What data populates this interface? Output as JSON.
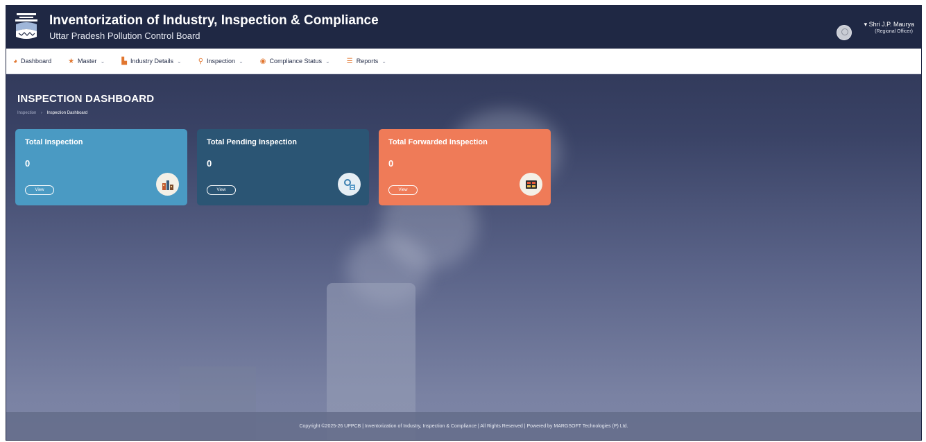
{
  "header": {
    "title": "Inventorization of Industry, Inspection & Compliance",
    "subtitle": "Uttar Pradesh Pollution Control Board",
    "user_name": "Shri J.P. Maurya",
    "user_role": "(Regional Officer)"
  },
  "nav": {
    "items": [
      {
        "label": "Dashboard",
        "icon": "dashboard-icon"
      },
      {
        "label": "Master",
        "icon": "star-icon"
      },
      {
        "label": "Industry Details",
        "icon": "factory-icon"
      },
      {
        "label": "Inspection",
        "icon": "search-icon"
      },
      {
        "label": "Compliance Status",
        "icon": "eye-icon"
      },
      {
        "label": "Reports",
        "icon": "list-icon"
      }
    ]
  },
  "page": {
    "title": "INSPECTION DASHBOARD",
    "breadcrumb": [
      "Inspection",
      "Inspection Dashboard"
    ]
  },
  "cards": [
    {
      "title": "Total Inspection",
      "value": "0",
      "button": "View",
      "icon": "factory-icon",
      "color": "#4a9ac3"
    },
    {
      "title": "Total Pending Inspection",
      "value": "0",
      "button": "View",
      "icon": "pending-icon",
      "color": "#2b5574"
    },
    {
      "title": "Total Forwarded Inspection",
      "value": "0",
      "button": "View",
      "icon": "forward-icon",
      "color": "#ef7b58"
    }
  ],
  "footer": {
    "text": "Copyright ©2025-26 UPPCB | Inventorization of Industry, Inspection & Compliance | All Rights Reserved | Powered by MARGSOFT Technologies (P) Ltd."
  }
}
